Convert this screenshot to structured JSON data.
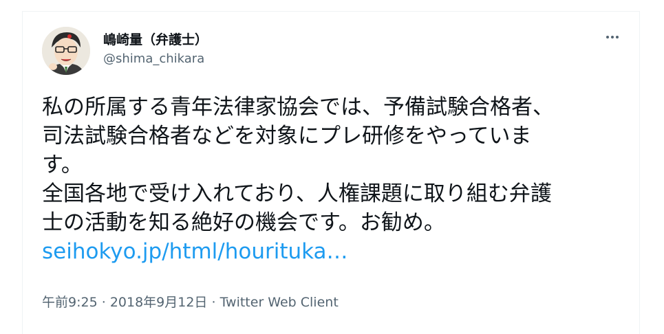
{
  "author": {
    "name": "嶋崎量（弁護士）",
    "handle": "@shima_chikara"
  },
  "tweet": {
    "line1": "私の所属する青年法律家協会では、予備試験合格者、",
    "line2": "司法試験合格者などを対象にプレ研修をやっていま",
    "line3": "す。",
    "line4": "全国各地で受け入れており、人権課題に取り組む弁護",
    "line5": "士の活動を知る絶好の機会です。お勧め。",
    "link": "seihokyo.jp/html/hourituka…"
  },
  "meta": {
    "time": "午前9:25",
    "separator1": "·",
    "date": "2018年9月12日",
    "separator2": "·",
    "client": "Twitter Web Client"
  },
  "icons": {
    "more": "more-horizontal-icon"
  }
}
